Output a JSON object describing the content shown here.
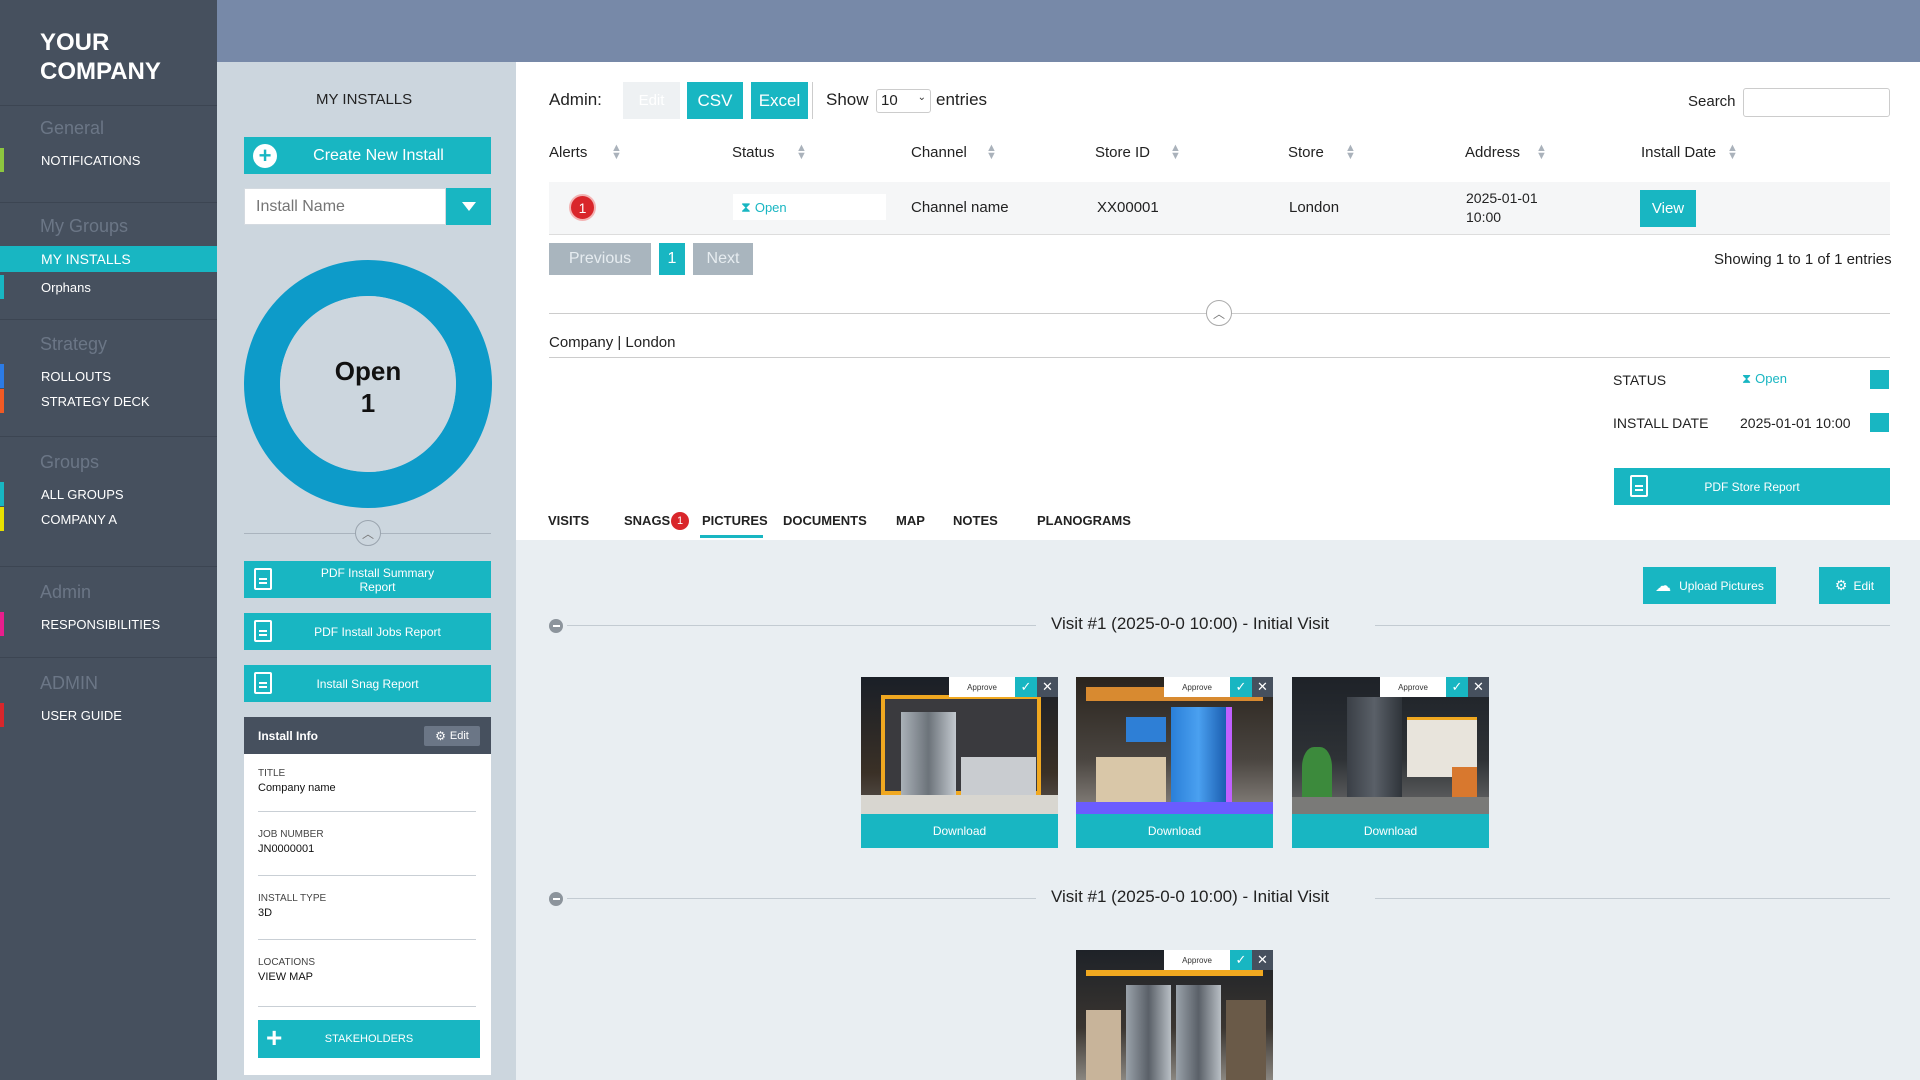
{
  "brand": {
    "line1": "YOUR",
    "line2": "COMPANY"
  },
  "sidebar": {
    "general": "General",
    "notifications": "NOTIFICATIONS",
    "my_groups": "My Groups",
    "my_installs": "MY INSTALLS",
    "orphans": "Orphans",
    "strategy": "Strategy",
    "rollouts": "ROLLOUTS",
    "strategy_deck": "STRATEGY DECK",
    "groups": "Groups",
    "all_groups": "ALL GROUPS",
    "company_a": "COMPANY A",
    "admin": "Admin",
    "responsibilities": "RESPONSIBILITIES",
    "admin_upper": "ADMIN",
    "user_guide": "USER GUIDE"
  },
  "colors": {
    "accent": "#18b6c2",
    "sidebar": "#46505e",
    "topband": "#7789a8",
    "alert": "#d9262b"
  },
  "panel": {
    "title": "MY INSTALLS",
    "create_button": "Create New Install",
    "install_name_placeholder": "Install Name",
    "donut_label": "Open",
    "donut_count": "1",
    "pdf_summary": "PDF Install Summary Report",
    "pdf_jobs": "PDF Install Jobs Report",
    "snag_report": "Install Snag Report",
    "install_info": "Install Info",
    "edit": "Edit",
    "title_label": "TITLE",
    "title_value": "Company name",
    "job_label": "JOB NUMBER",
    "job_value": "JN0000001",
    "type_label": "INSTALL TYPE",
    "type_value": "3D",
    "loc_label": "LOCATIONS",
    "loc_value": "VIEW MAP",
    "stakeholders": "STAKEHOLDERS"
  },
  "toolbar": {
    "admin": "Admin:",
    "edit": "Edit",
    "csv": "CSV",
    "excel": "Excel",
    "show": "Show",
    "entries_value": "10",
    "entries": "entries",
    "search": "Search"
  },
  "table": {
    "headers": [
      "Alerts",
      "Status",
      "Channel",
      "Store ID",
      "Store",
      "Address",
      "Install Date"
    ],
    "row": {
      "alerts": "1",
      "status": "Open",
      "channel": "Channel name",
      "store_id": "XX00001",
      "store": "London",
      "address_l1": "2025-01-01",
      "address_l2": "10:00",
      "view": "View"
    }
  },
  "pagination": {
    "previous": "Previous",
    "page": "1",
    "next": "Next",
    "showing": "Showing 1 to 1 of 1 entries"
  },
  "detail": {
    "breadcrumb": "Company | London",
    "status_label": "STATUS",
    "status_value": "Open",
    "date_label": "INSTALL DATE",
    "date_value": "2025-01-01 10:00",
    "pdf_store": "PDF Store Report"
  },
  "tabs": [
    "VISITS",
    "SNAGS",
    "PICTURES",
    "DOCUMENTS",
    "MAP",
    "NOTES",
    "PLANOGRAMS"
  ],
  "snags_badge": "1",
  "gallery": {
    "upload": "Upload Pictures",
    "edit": "Edit",
    "visit1": "Visit #1 (2025-0-0 10:00) - Initial Visit",
    "visit2": "Visit #1 (2025-0-0 10:00) - Initial Visit",
    "approve": "Approve",
    "download": "Download"
  }
}
